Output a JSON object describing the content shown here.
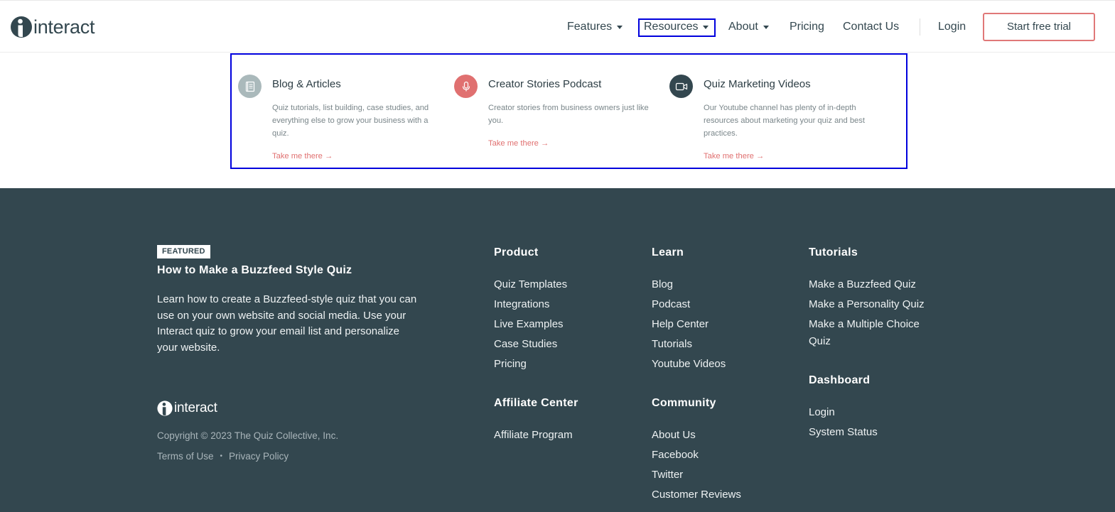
{
  "header": {
    "logo_text": "interact",
    "nav": [
      {
        "label": "Features",
        "has_caret": true
      },
      {
        "label": "Resources",
        "has_caret": true,
        "active": true
      },
      {
        "label": "About",
        "has_caret": true
      },
      {
        "label": "Pricing",
        "has_caret": false
      },
      {
        "label": "Contact Us",
        "has_caret": false
      },
      {
        "label": "Login",
        "has_caret": false
      }
    ],
    "cta_label": "Start free trial"
  },
  "resources_menu": {
    "items": [
      {
        "icon": "book-icon",
        "icon_color": "#aab9bb",
        "title": "Blog & Articles",
        "description": "Quiz tutorials, list building, case studies, and everything else to grow your business with a quiz.",
        "link": "Take me there →"
      },
      {
        "icon": "microphone-icon",
        "icon_color": "#e07070",
        "title": "Creator Stories Podcast",
        "description": "Creator stories from business owners just like you.",
        "link": "Take me there →"
      },
      {
        "icon": "video-camera-icon",
        "icon_color": "#33474f",
        "title": "Quiz Marketing Videos",
        "description": "Our Youtube channel has plenty of in-depth resources about marketing your quiz and best practices.",
        "link": "Take me there →"
      }
    ]
  },
  "footer": {
    "featured": {
      "badge": "FEATURED",
      "title": "How to Make a Buzzfeed Style Quiz",
      "description": "Learn how to create a Buzzfeed-style quiz that you can use on your own website and social media. Use your Interact quiz to grow your email list and personalize your website."
    },
    "logo_text": "interact",
    "copyright": "Copyright © 2023 The Quiz Collective, Inc.",
    "legal": {
      "terms": "Terms of Use",
      "separator": "•",
      "privacy": "Privacy Policy"
    },
    "product": {
      "title": "Product",
      "links": [
        "Quiz Templates",
        "Integrations",
        "Live Examples",
        "Case Studies",
        "Pricing"
      ]
    },
    "affiliate": {
      "title": "Affiliate Center",
      "links": [
        "Affiliate Program"
      ]
    },
    "learn": {
      "title": "Learn",
      "links": [
        "Blog",
        "Podcast",
        "Help Center",
        "Tutorials",
        "Youtube Videos"
      ]
    },
    "community": {
      "title": "Community",
      "links": [
        "About Us",
        "Facebook",
        "Twitter",
        "Customer Reviews"
      ]
    },
    "tutorials": {
      "title": "Tutorials",
      "links": [
        "Make a Buzzfeed Quiz",
        "Make a Personality Quiz",
        "Make a Multiple Choice Quiz"
      ]
    },
    "dashboard": {
      "title": "Dashboard",
      "links": [
        "Login",
        "System Status"
      ]
    }
  },
  "colors": {
    "brand_dark": "#33474f",
    "accent_coral": "#e07070",
    "highlight_box": "#0000dd"
  }
}
